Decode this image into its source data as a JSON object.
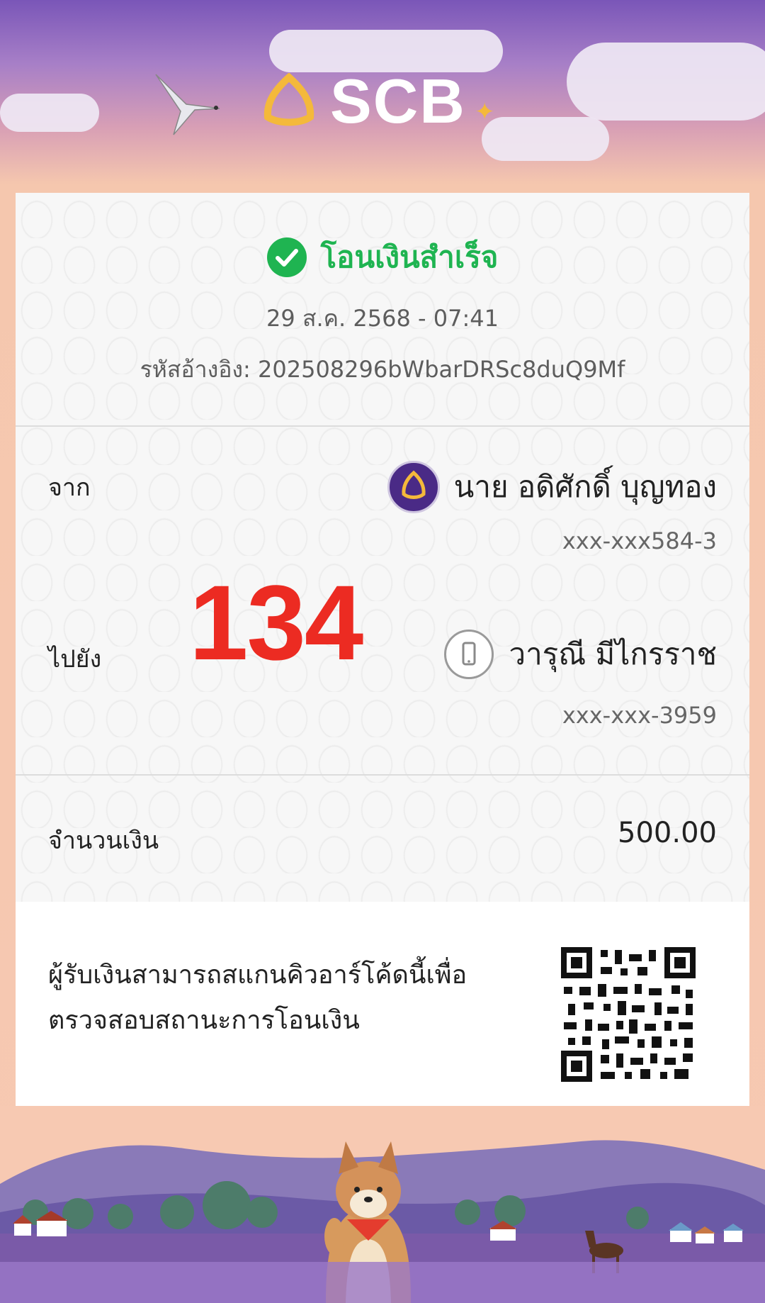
{
  "brand": {
    "logo_text": "SCB"
  },
  "status": {
    "label": "โอนเงินสำเร็จ",
    "icon": "check-circle-icon",
    "color": "#1fb451"
  },
  "datetime": "29 ส.ค. 2568 - 07:41",
  "reference": {
    "label": "รหัสอ้างอิง:",
    "value": "202508296bWbarDRSc8duQ9Mf"
  },
  "from": {
    "label": "จาก",
    "name": "นาย อดิศักดิ์ บุญทอง",
    "account": "xxx-xxx584-3",
    "icon": "scb-bank-icon"
  },
  "to": {
    "label": "ไปยัง",
    "name": "วารุณี มีไกรราช",
    "account": "xxx-xxx-3959",
    "icon": "phone-icon"
  },
  "overlay_number": "134",
  "amount": {
    "label": "จำนวนเงิน",
    "value": "500.00"
  },
  "qr_note": "ผู้รับเงินสามารถสแกนคิวอาร์โค้ดนี้เพื่อตรวจสอบสถานะการโอนเงิน",
  "colors": {
    "accent_purple": "#4a2a86",
    "highlight_red": "#ec2b22",
    "gold": "#f4b93b"
  }
}
